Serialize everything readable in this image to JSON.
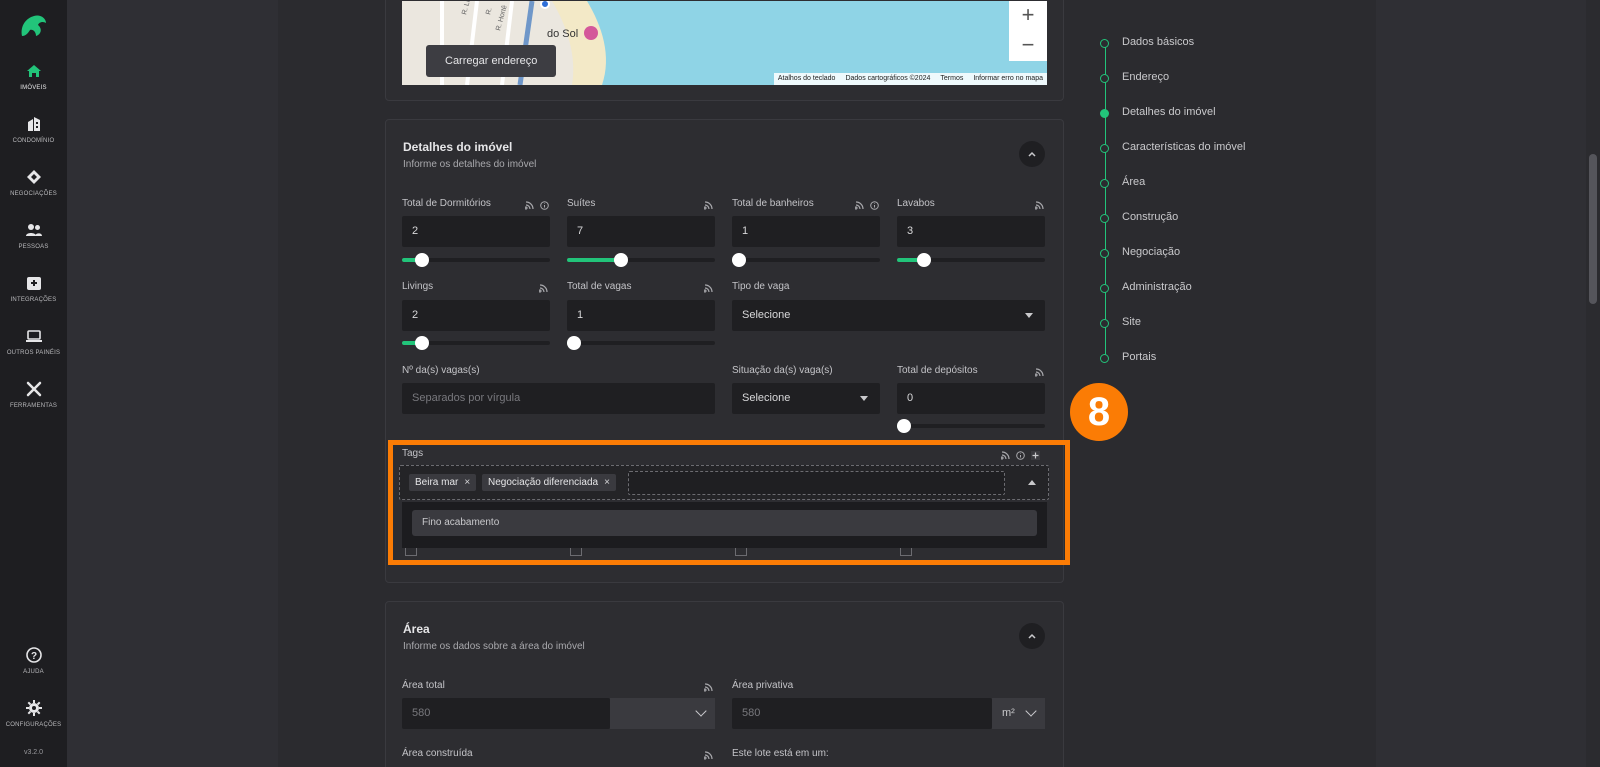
{
  "sidebar": {
    "items": [
      {
        "label": "IMÓVEIS",
        "icon": "home-icon"
      },
      {
        "label": "CONDOMÍNIO",
        "icon": "building-icon"
      },
      {
        "label": "NEGOCIAÇÕES",
        "icon": "handshake-icon"
      },
      {
        "label": "PESSOAS",
        "icon": "people-icon"
      },
      {
        "label": "INTEGRAÇÕES",
        "icon": "integration-icon"
      },
      {
        "label": "OUTROS PAINÉIS",
        "icon": "laptop-icon"
      },
      {
        "label": "FERRAMENTAS",
        "icon": "tools-icon"
      }
    ],
    "help": "AJUDA",
    "settings": "CONFIGURAÇÕES",
    "version": "v3.2.0",
    "accent": "#22c47a"
  },
  "map": {
    "load_button": "Carregar endereço",
    "zoom_in": "+",
    "zoom_out": "−",
    "label_sol": "do Sol",
    "attrib": [
      "Atalhos do teclado",
      "Dados cartográficos ©2024",
      "Termos",
      "Informar erro no mapa"
    ]
  },
  "details": {
    "title": "Detalhes do imóvel",
    "subtitle": "Informe os detalhes do imóvel",
    "fields": {
      "dormitorios": {
        "label": "Total de Dormitórios",
        "value": "2"
      },
      "suites": {
        "label": "Suítes",
        "value": "7"
      },
      "banheiros": {
        "label": "Total de banheiros",
        "value": "1"
      },
      "lavabos": {
        "label": "Lavabos",
        "value": "3"
      },
      "livings": {
        "label": "Livings",
        "value": "2"
      },
      "vagas": {
        "label": "Total de vagas",
        "value": "1"
      },
      "tipo_vaga": {
        "label": "Tipo de vaga",
        "value": "Selecione"
      },
      "num_vagas": {
        "label": "Nº da(s) vagas(s)",
        "placeholder": "Separados por vírgula"
      },
      "situacao_vaga": {
        "label": "Situação da(s) vaga(s)",
        "value": "Selecione"
      },
      "depositos": {
        "label": "Total de depósitos",
        "value": "0"
      }
    },
    "sliders": {
      "dormitorios": 0.1,
      "suites": 0.35,
      "banheiros": 0.0,
      "lavabos": 0.15,
      "livings": 0.1,
      "vagas": 0.0,
      "depositos": 0.0
    },
    "tags": {
      "label": "Tags",
      "chips": [
        "Beira mar",
        "Negociação diferenciada"
      ],
      "option": "Fino acabamento",
      "remove": "×"
    }
  },
  "annotation": {
    "number": "8",
    "color": "#fb7c05"
  },
  "area": {
    "title": "Área",
    "subtitle": "Informe os dados sobre a área do imóvel",
    "total": {
      "label": "Área total",
      "value": "580"
    },
    "privativa": {
      "label": "Área privativa",
      "value": "580",
      "unit": "m²"
    },
    "construida": {
      "label": "Área construída"
    },
    "lote": {
      "label": "Este lote está em um:"
    }
  },
  "steps": [
    {
      "label": "Dados básicos"
    },
    {
      "label": "Endereço"
    },
    {
      "label": "Detalhes do imóvel",
      "active": true
    },
    {
      "label": "Características do imóvel"
    },
    {
      "label": "Área"
    },
    {
      "label": "Construção"
    },
    {
      "label": "Negociação"
    },
    {
      "label": "Administração"
    },
    {
      "label": "Site"
    },
    {
      "label": "Portais"
    }
  ]
}
